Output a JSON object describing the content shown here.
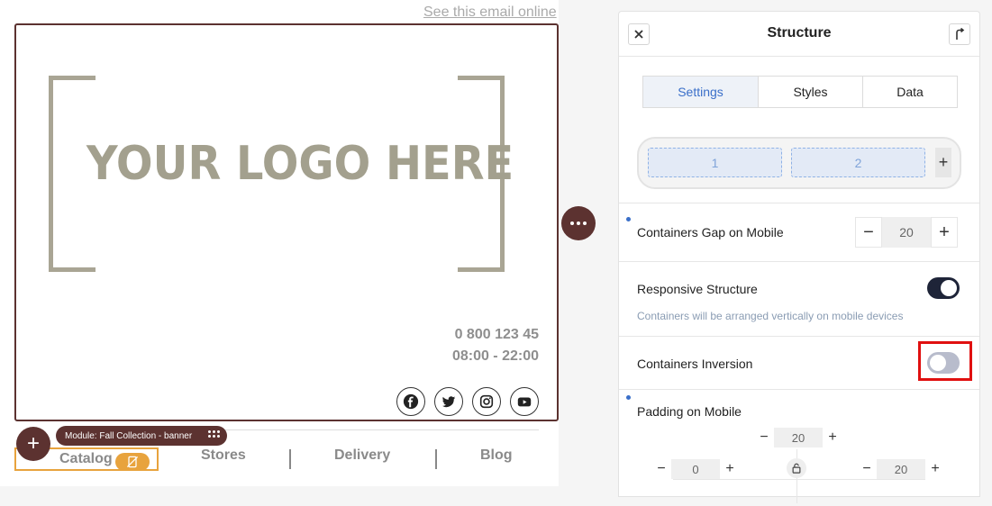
{
  "email": {
    "see_online": "See this email online",
    "logo_text": "YOUR LOGO HERE",
    "phone": "0 800 123 45",
    "hours": "08:00 - 22:00",
    "socials": [
      "facebook-icon",
      "twitter-icon",
      "instagram-icon",
      "youtube-icon"
    ],
    "module_label": "Module: Fall Collection - banner",
    "nav": [
      "Catalog",
      "Stores",
      "Delivery",
      "Blog"
    ]
  },
  "panel": {
    "title": "Structure",
    "tabs": [
      "Settings",
      "Styles",
      "Data"
    ],
    "columns": [
      "1",
      "2"
    ],
    "add_column": "+",
    "gap_label": "Containers Gap on Mobile",
    "gap_value": "20",
    "responsive_label": "Responsive Structure",
    "responsive_note": "Containers will be arranged vertically on mobile devices",
    "responsive_on": true,
    "inversion_label": "Containers Inversion",
    "inversion_on": false,
    "padding_label": "Padding on Mobile",
    "padding_top": "20",
    "padding_left": "0",
    "padding_right": "20"
  },
  "colors": {
    "brand": "#5c3230",
    "accent": "#e8a33d",
    "link_blue": "#3a6fc9",
    "highlight": "#e01010"
  }
}
